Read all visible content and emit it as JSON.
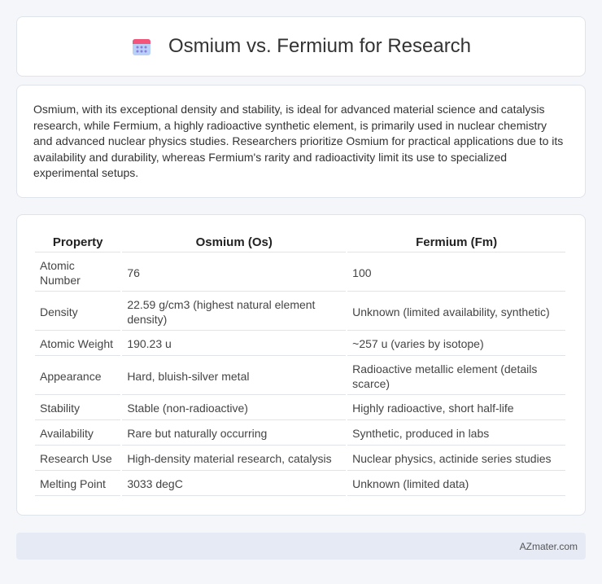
{
  "header": {
    "title": "Osmium vs. Fermium for Research",
    "icon": "calendar-grid-icon"
  },
  "intro": {
    "text": "Osmium, with its exceptional density and stability, is ideal for advanced material science and catalysis research, while Fermium, a highly radioactive synthetic element, is primarily used in nuclear chemistry and advanced nuclear physics studies. Researchers prioritize Osmium for practical applications due to its availability and durability, whereas Fermium's rarity and radioactivity limit its use to specialized experimental setups."
  },
  "table": {
    "headers": [
      "Property",
      "Osmium (Os)",
      "Fermium (Fm)"
    ],
    "rows": [
      [
        "Atomic Number",
        "76",
        "100"
      ],
      [
        "Density",
        "22.59 g/cm3 (highest natural element density)",
        "Unknown (limited availability, synthetic)"
      ],
      [
        "Atomic Weight",
        "190.23 u",
        "~257 u (varies by isotope)"
      ],
      [
        "Appearance",
        "Hard, bluish-silver metal",
        "Radioactive metallic element (details scarce)"
      ],
      [
        "Stability",
        "Stable (non-radioactive)",
        "Highly radioactive, short half-life"
      ],
      [
        "Availability",
        "Rare but naturally occurring",
        "Synthetic, produced in labs"
      ],
      [
        "Research Use",
        "High-density material research, catalysis",
        "Nuclear physics, actinide series studies"
      ],
      [
        "Melting Point",
        "3033 degC",
        "Unknown (limited data)"
      ]
    ]
  },
  "footer": {
    "brand": "AZmater.com"
  },
  "colors": {
    "icon_top": "#f2547a",
    "icon_body": "#a9c4f5",
    "icon_dots": "#8a7de0",
    "footer_bg": "#e6eaf5"
  }
}
